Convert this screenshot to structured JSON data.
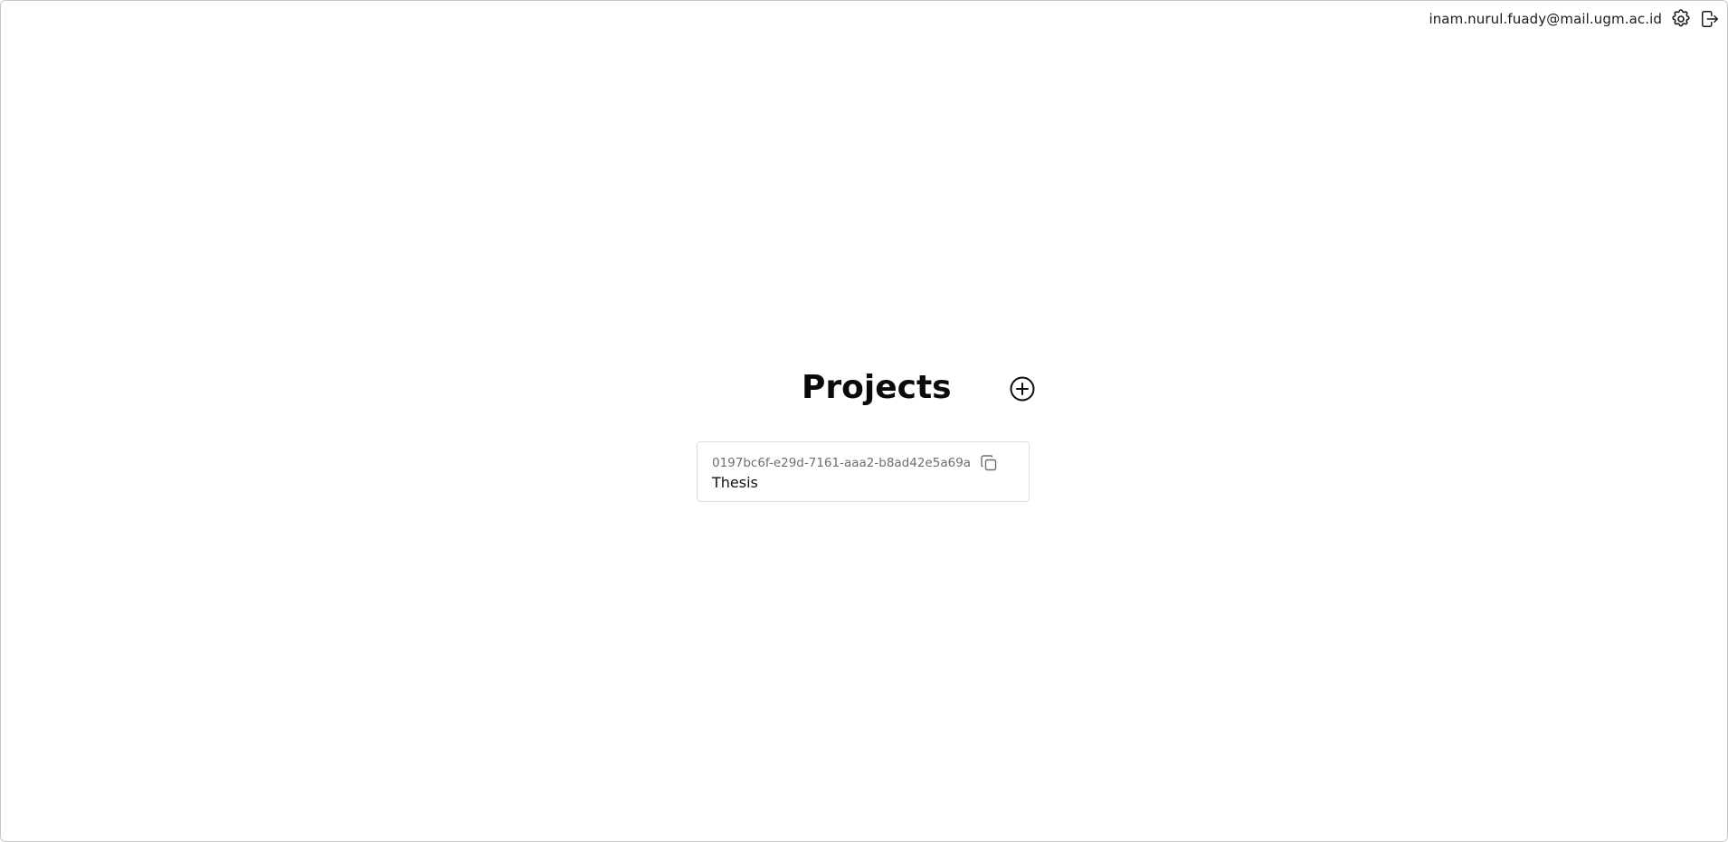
{
  "header": {
    "user_email": "inam.nurul.fuady@mail.ugm.ac.id",
    "settings_icon": "gear-icon",
    "logout_icon": "logout-icon"
  },
  "main": {
    "title": "Projects",
    "add_icon": "plus-circle-icon",
    "projects": [
      {
        "id": "0197bc6f-e29d-7161-aaa2-b8ad42e5a69a",
        "name": "Thesis",
        "copy_icon": "copy-icon"
      }
    ]
  },
  "colors": {
    "text": "#111111",
    "muted": "#6e6e6e",
    "border": "#dedede"
  }
}
